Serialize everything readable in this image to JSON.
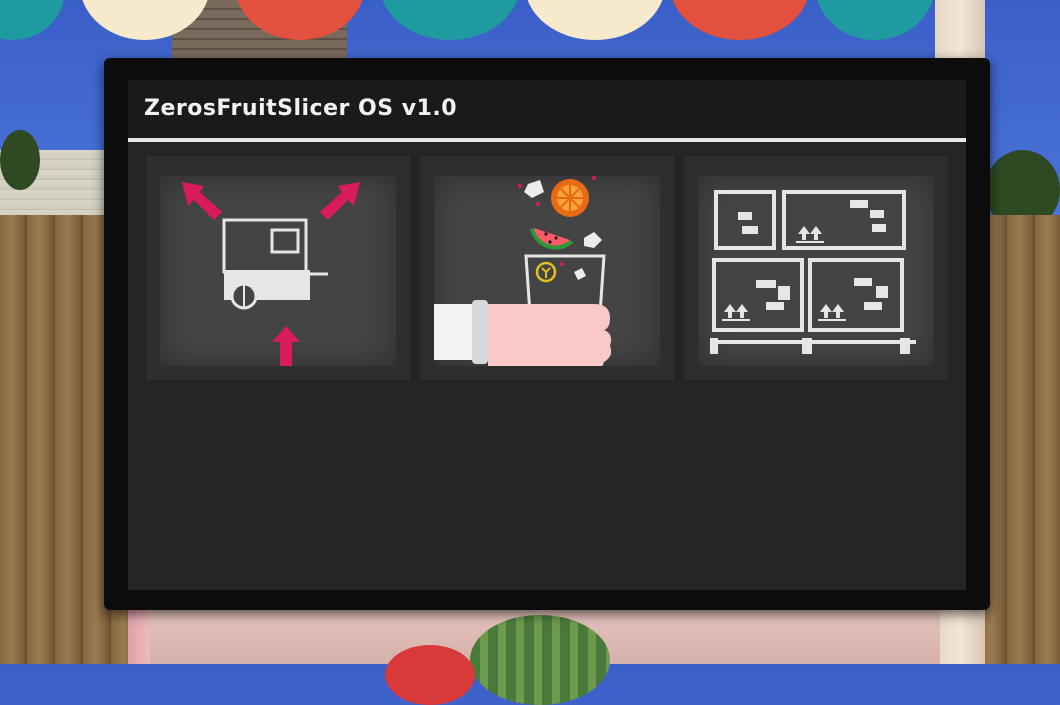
{
  "window": {
    "title": "ZerosFruitSlicer OS v1.0"
  },
  "tiles": [
    {
      "icon": "cart-placement-icon"
    },
    {
      "icon": "fruit-juice-hand-icon"
    },
    {
      "icon": "storage-boxes-icon"
    }
  ],
  "colors": {
    "screen_bg": "#252525",
    "title_bar": "#1a1a1a",
    "title_text": "#f2f2f2",
    "accent_arrow": "#d81b5a",
    "tile_bg": "#444444",
    "icon_stroke": "#e8e8e8"
  }
}
